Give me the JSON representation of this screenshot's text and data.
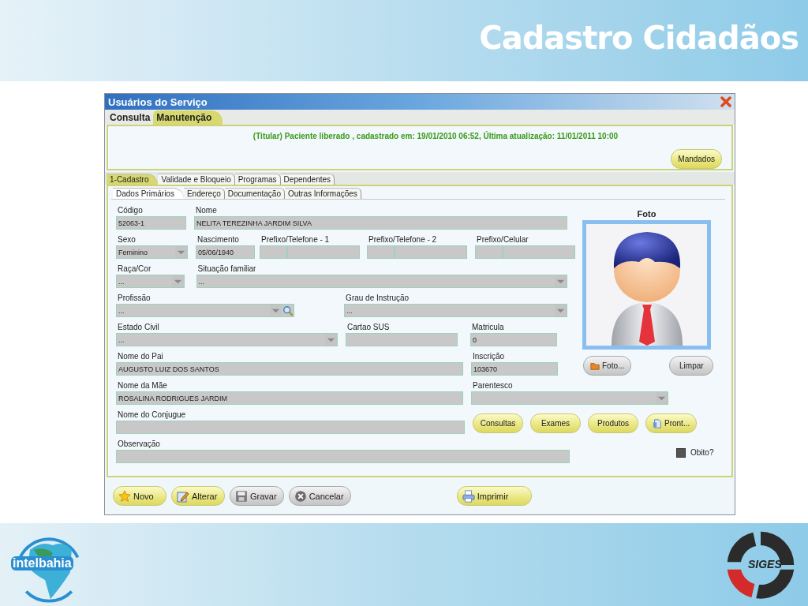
{
  "slide": {
    "title": "Cadastro Cidadãos",
    "logos": [
      {
        "kind": "intelbahia",
        "text": "intelbahia"
      },
      {
        "kind": "siges",
        "text": "SIGES"
      }
    ]
  },
  "window": {
    "title": "Usuários do Serviço"
  },
  "main_tabs": [
    {
      "label": "Consulta",
      "selected": false
    },
    {
      "label": "Manutenção",
      "selected": true
    }
  ],
  "status_message": "(Titular) Paciente liberado , cadastrado em: 19/01/2010 06:52, Última atualização: 11/01/2011 10:00",
  "header_buttons": [
    {
      "label": "Mandados",
      "disabled": false
    }
  ],
  "section_tabs": [
    {
      "label": "1-Cadastro",
      "selected": true
    },
    {
      "label": "Validade e Bloqueio",
      "selected": false
    },
    {
      "label": "Programas",
      "selected": false
    },
    {
      "label": "Dependentes",
      "selected": false
    }
  ],
  "sub_tabs": [
    {
      "label": "Dados Primários",
      "selected": true
    },
    {
      "label": "Endereço",
      "selected": false
    },
    {
      "label": "Documentação",
      "selected": false
    },
    {
      "label": "Outras Informações",
      "selected": false
    }
  ],
  "photo": {
    "label": "Foto"
  },
  "form_rows": [
    [
      {
        "kind": "text",
        "label": "Código",
        "value": "52063-1"
      },
      {
        "kind": "text",
        "label": "Nome",
        "value": "NELITA TEREZINHA JARDIM SILVA"
      }
    ],
    [
      {
        "kind": "select",
        "label": "Sexo",
        "value": "Feminino"
      },
      {
        "kind": "text",
        "label": "Nascimento",
        "value": "05/06/1940"
      },
      {
        "kind": "phone",
        "label": "Prefixo/Telefone - 1"
      },
      {
        "kind": "phone",
        "label": "Prefixo/Telefone - 2"
      },
      {
        "kind": "phone",
        "label": "Prefixo/Celular"
      }
    ],
    [
      {
        "kind": "select",
        "label": "Raça/Cor",
        "value": "..."
      },
      {
        "kind": "select",
        "label": "Situação familiar",
        "value": "..."
      }
    ],
    [
      {
        "kind": "search_select",
        "label": "Profissão",
        "value": "..."
      },
      {
        "kind": "select",
        "label": "Grau de Instrução",
        "value": "..."
      }
    ],
    [
      {
        "kind": "select",
        "label": "Estado Civil",
        "value": "..."
      },
      {
        "kind": "text",
        "label": "Cartao SUS"
      },
      {
        "kind": "text",
        "label": "Matricula",
        "value": "0"
      }
    ],
    [
      {
        "kind": "text",
        "label": "Nome do Pai",
        "value": "AUGUSTO LUIZ DOS SANTOS"
      },
      {
        "kind": "text",
        "label": "Inscrição",
        "value": "103670"
      },
      {
        "kind": "buttons",
        "buttons": [
          {
            "label": "Foto...",
            "kind": "folder",
            "disabled": true
          },
          {
            "label": "Limpar",
            "kind": "plain",
            "disabled": true
          }
        ]
      }
    ],
    [
      {
        "kind": "text",
        "label": "Nome da Mãe",
        "value": "ROSALINA RODRIGUES JARDIM"
      },
      {
        "kind": "select",
        "label": "Parentesco"
      }
    ],
    [
      {
        "kind": "text",
        "label": "Nome do Conjugue"
      },
      {
        "kind": "buttons",
        "buttons": [
          {
            "label": "Consultas",
            "kind": "plain",
            "disabled": false
          },
          {
            "label": "Exames",
            "kind": "plain",
            "disabled": false
          },
          {
            "label": "Produtos",
            "kind": "plain",
            "disabled": false
          },
          {
            "label": "Pront...",
            "kind": "document",
            "disabled": false
          }
        ]
      }
    ],
    [
      {
        "kind": "text",
        "label": "Observação"
      },
      {
        "kind": "checkbox",
        "label": "Obito?",
        "checked": false
      }
    ]
  ],
  "toolbar_buttons": [
    {
      "label": "Novo",
      "kind": "star",
      "disabled": false
    },
    {
      "label": "Alterar",
      "kind": "edit",
      "disabled": false
    },
    {
      "label": "Gravar",
      "kind": "floppy",
      "disabled": true
    },
    {
      "label": "Cancelar",
      "kind": "cancel",
      "disabled": true
    },
    {
      "label": "Imprimir",
      "kind": "printer",
      "disabled": false
    }
  ]
}
